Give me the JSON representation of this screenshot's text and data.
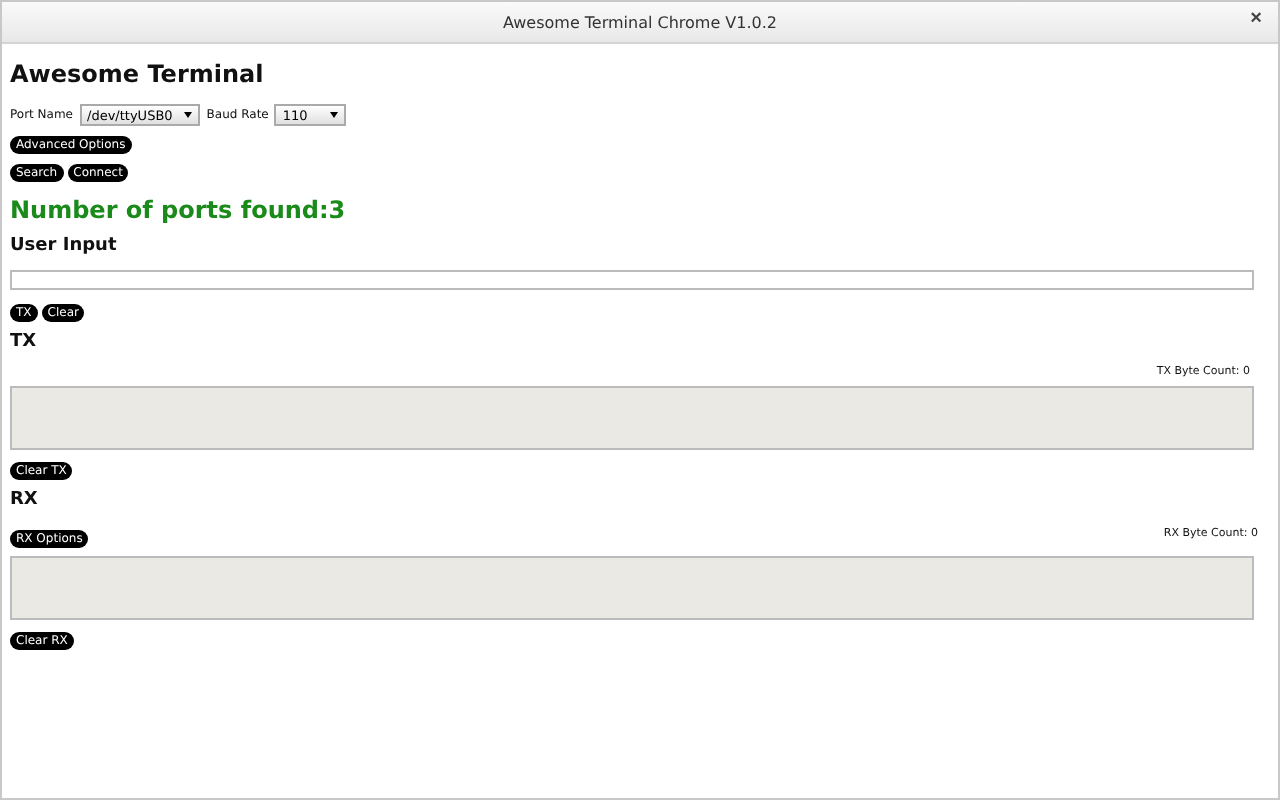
{
  "window": {
    "title": "Awesome Terminal Chrome V1.0.2",
    "close": "×"
  },
  "heading": "Awesome Terminal",
  "port": {
    "label": "Port Name",
    "value": "/dev/ttyUSB0"
  },
  "baud": {
    "label": "Baud Rate",
    "value": "110"
  },
  "advanced_button": "Advanced Options",
  "action_buttons": [
    "Search",
    "Connect"
  ],
  "status": "Number of ports found:3",
  "user_input": {
    "label": "User Input",
    "buttons": [
      "TX",
      "Clear"
    ]
  },
  "tx": {
    "label": "TX",
    "count": "TX Byte Count: 0",
    "button": "Clear TX"
  },
  "rx": {
    "label": "RX",
    "count": "RX Byte Count: 0",
    "options_button": "RX Options",
    "button": "Clear RX"
  }
}
